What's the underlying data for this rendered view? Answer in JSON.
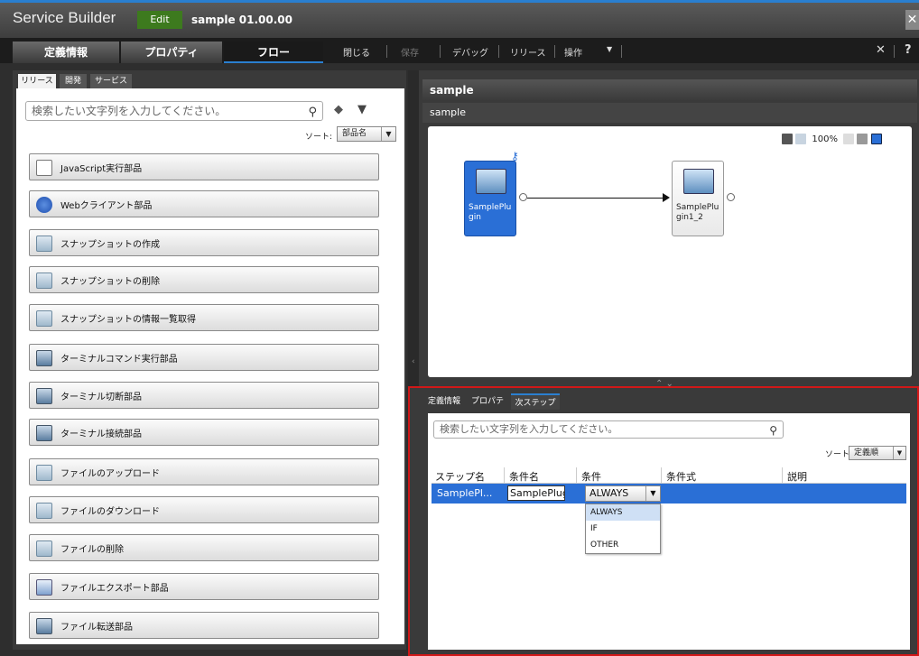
{
  "titlebar": {
    "app_title": "Service Builder",
    "edit_badge": "Edit",
    "doc_name": "sample 01.00.00",
    "close": "✕"
  },
  "menubar": {
    "tabs": [
      "定義情報",
      "プロパティ",
      "フロー"
    ],
    "active_tab": "フロー",
    "toolbar": [
      "閉じる",
      "保存",
      "デバッグ",
      "リリース",
      "操作"
    ],
    "disabled": [
      "保存"
    ],
    "dropdown_arrow": "▼",
    "right_close": "✕",
    "help": "?"
  },
  "left": {
    "tabs": [
      "リリース",
      "開発",
      "サービス"
    ],
    "active_tab": "リリース",
    "search_placeholder": "検索したい文字列を入力してください。",
    "sort_label": "ソート:",
    "sort_value": "部品名",
    "items": [
      {
        "label": "JavaScript実行部品",
        "icon": "js-icon"
      },
      {
        "label": "Webクライアント部品",
        "icon": "globe-icon"
      },
      {
        "label": "スナップショットの作成",
        "icon": "cube-icon"
      },
      {
        "label": "スナップショットの削除",
        "icon": "cube-icon"
      },
      {
        "label": "スナップショットの情報一覧取得",
        "icon": "cube-icon"
      },
      {
        "label": "ターミナルコマンド実行部品",
        "icon": "terminal-icon"
      },
      {
        "label": "ターミナル切断部品",
        "icon": "terminal-disconnect-icon"
      },
      {
        "label": "ターミナル接続部品",
        "icon": "terminal-connect-icon"
      },
      {
        "label": "ファイルのアップロード",
        "icon": "cube-icon"
      },
      {
        "label": "ファイルのダウンロード",
        "icon": "cube-icon"
      },
      {
        "label": "ファイルの削除",
        "icon": "cube-icon"
      },
      {
        "label": "ファイルエクスポート部品",
        "icon": "export-icon"
      },
      {
        "label": "ファイル転送部品",
        "icon": "transfer-icon"
      }
    ]
  },
  "flow": {
    "header": "sample",
    "subheader": "sample",
    "zoom": "100%",
    "nodes": [
      {
        "label": "SamplePlugin",
        "display": "SamplePlu gin",
        "selected": true
      },
      {
        "label": "SamplePlugin1_2",
        "display": "SamplePlu gin1_2",
        "selected": false
      }
    ]
  },
  "next_step": {
    "tabs": [
      "定義情報",
      "プロパティ",
      "次ステップ"
    ],
    "active_tab": "次ステップ",
    "search_placeholder": "検索したい文字列を入力してください。",
    "sort_label": "ソート:",
    "sort_value": "定義順",
    "columns": [
      "ステップ名",
      "条件名",
      "条件",
      "条件式",
      "説明"
    ],
    "row": {
      "step_name": "SamplePl...",
      "condition_name": "SamplePlugi",
      "condition": "ALWAYS",
      "expression": "",
      "description": ""
    },
    "options": [
      "ALWAYS",
      "IF",
      "OTHER"
    ],
    "highlighted_option": "ALWAYS"
  },
  "colors": {
    "accent": "#2a7fd0",
    "selection": "#2a6fd6",
    "edit_badge": "#3d7a1e",
    "highlight_frame": "#d01818"
  }
}
